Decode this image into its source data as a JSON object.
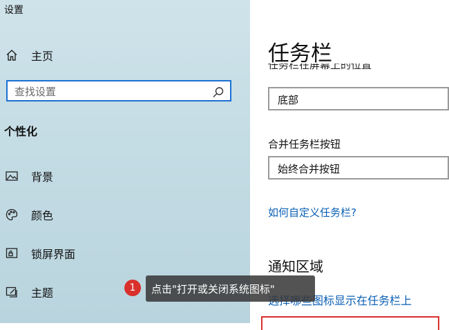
{
  "window": {
    "title": "设置"
  },
  "sidebar": {
    "home_label": "主页",
    "search": {
      "placeholder": "查找设置",
      "value": ""
    },
    "section_title": "个性化",
    "items": [
      {
        "label": "背景",
        "icon": "image-icon"
      },
      {
        "label": "颜色",
        "icon": "palette-icon"
      },
      {
        "label": "锁屏界面",
        "icon": "lock-screen-icon"
      },
      {
        "label": "主题",
        "icon": "theme-icon"
      }
    ]
  },
  "main": {
    "title": "任务栏",
    "clipped_label": "任务栏在屏幕上的位置",
    "location_value": "底部",
    "combine_label": "合并任务栏按钮",
    "combine_value": "始终合并按钮",
    "customize_link": "如何自定义任务栏?",
    "notification_heading": "通知区域",
    "partial_link": "选择哪些图标显示在任务栏上"
  },
  "annotation": {
    "step": "1",
    "tooltip": "点击\"打开或关闭系统图标\""
  },
  "colors": {
    "accent": "#1a6fd0",
    "link": "#0a5fb4",
    "highlight": "#d9302b",
    "tooltip_bg": "#373737"
  }
}
